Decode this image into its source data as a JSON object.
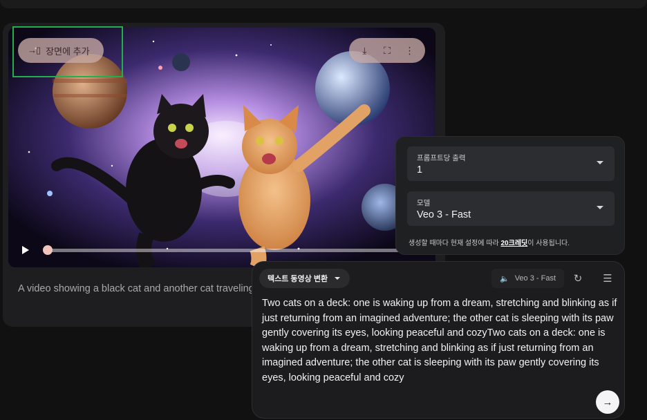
{
  "video": {
    "add_to_scene_label": "장면에 추가",
    "tools": {
      "download": "download-icon",
      "fullscreen": "fullscreen-icon",
      "more": "more-vert-icon"
    },
    "progress_fraction": 0.01,
    "description": "A video showing a black cat and another cat traveling together. The cats look excited and happy, and they"
  },
  "settings": {
    "outputs_label": "프롬프트당 출력",
    "outputs_value": "1",
    "model_label": "모델",
    "model_value": "Veo 3 - Fast",
    "note_prefix": "생성할 때마다 현재 설정에 따라 ",
    "note_credits": "20크레딧",
    "note_suffix": "이 사용됩니다."
  },
  "prompt": {
    "mode_label": "텍스트 동영상 변환",
    "model_chip": "Veo 3 - Fast",
    "text": "Two cats on a deck: one is waking up from a dream, stretching and blinking as if just returning from an imagined adventure; the other cat is sleeping with its paw gently covering its eyes, looking peaceful and cozyTwo cats on a deck: one is waking up from a dream, stretching and blinking as if just returning from an imagined adventure; the other cat is sleeping with its paw gently covering its eyes, looking peaceful and cozy"
  },
  "colors": {
    "highlight": "#21b04b",
    "chip": "#c8aaa5"
  }
}
